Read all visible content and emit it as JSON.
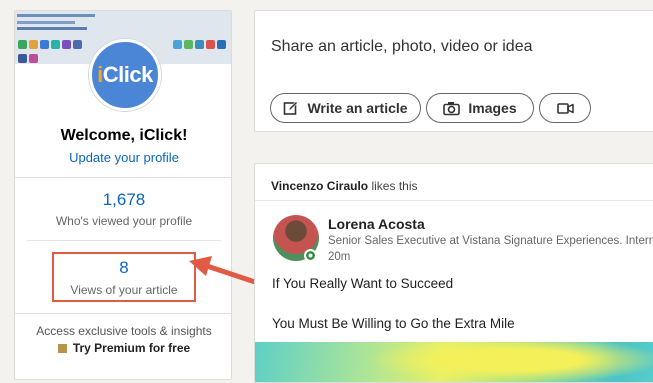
{
  "profile": {
    "avatar_text_a": "i",
    "avatar_text_b": "Click",
    "welcome": "Welcome, iClick!",
    "update_link": "Update your profile",
    "profile_views_count": "1,678",
    "profile_views_label": "Who's viewed your profile",
    "article_views_count": "8",
    "article_views_label": "Views of your article",
    "premium_text": "Access exclusive tools & insights",
    "premium_cta": "Try Premium for free"
  },
  "share": {
    "prompt": "Share an article, photo, video or idea",
    "write_article": "Write an article",
    "images": "Images"
  },
  "feed": {
    "actor": "Vincenzo Ciraulo",
    "action": " likes this",
    "author_name": "Lorena Acosta",
    "author_headline": "Senior Sales Executive at Vistana Signature Experiences. Intern",
    "post_time": "20m",
    "post_line_1": "If You Really Want to Succeed",
    "post_line_2": "You Must Be Willing to Go the Extra Mile"
  },
  "colors": {
    "link_blue": "#0a66c2",
    "highlight_red": "#e05a44",
    "avatar_blue": "#4b86d6",
    "presence_green": "#2e8b3b"
  },
  "icons": {
    "write": "pencil-square-icon",
    "images": "camera-icon",
    "video": "video-camera-icon",
    "premium": "premium-badge-icon"
  }
}
